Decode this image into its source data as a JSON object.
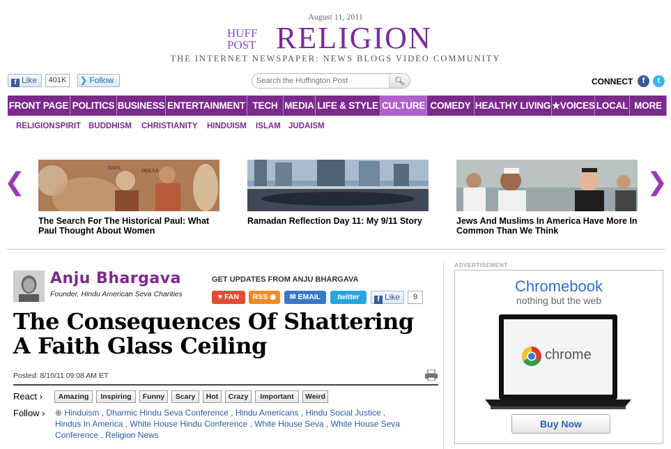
{
  "date": "August 11, 2011",
  "logo": {
    "huff": "HUFF",
    "post": "POST",
    "section": "RELIGION"
  },
  "tagline": "THE INTERNET NEWSPAPER: NEWS BLOGS VIDEO COMMUNITY",
  "social": {
    "like_label": "Like",
    "like_count": "401K",
    "follow_label": "Follow"
  },
  "search": {
    "placeholder": "Search the Huffington Post"
  },
  "connect": {
    "label": "CONNECT",
    "icons": [
      "facebook-icon",
      "twitter-icon"
    ]
  },
  "nav": {
    "items": [
      {
        "label": "FRONT PAGE",
        "active": false
      },
      {
        "label": "POLITICS",
        "active": false
      },
      {
        "label": "BUSINESS",
        "active": false
      },
      {
        "label": "ENTERTAINMENT",
        "active": false
      },
      {
        "label": "TECH",
        "active": false
      },
      {
        "label": "MEDIA",
        "active": false
      },
      {
        "label": "LIFE & STYLE",
        "active": false
      },
      {
        "label": "CULTURE",
        "active": true
      },
      {
        "label": "COMEDY",
        "active": false
      },
      {
        "label": "HEALTHY LIVING",
        "active": false
      },
      {
        "label": "★VOICES",
        "active": false
      },
      {
        "label": "LOCAL",
        "active": false
      },
      {
        "label": "MORE",
        "active": false
      }
    ],
    "bg_color": "#7b2a8c",
    "active_color": "#b061c9"
  },
  "subnav": [
    "RELIGION",
    "SPIRIT",
    "BUDDHISM",
    "CHRISTIANITY",
    "HINDUISM",
    "ISLAM",
    "JUDAISM"
  ],
  "carousel": [
    {
      "caption": "The Search For The Historical Paul: What Paul Thought About Women"
    },
    {
      "caption": "Ramadan Reflection Day 11: My 9/11 Story"
    },
    {
      "caption": "Jews And Muslims In America Have More In Common Than We Think"
    }
  ],
  "author": {
    "name": "Anju Bhargava",
    "title": "Founder, Hindu American Seva Charities"
  },
  "updates": {
    "label": "GET UPDATES FROM ANJU BHARGAVA",
    "fan": "FAN",
    "rss": "RSS",
    "email": "EMAIL",
    "twitter": "twitter",
    "like": "Like",
    "like_count": "9"
  },
  "article": {
    "headline": "The Consequences Of Shattering A Faith Glass Ceiling",
    "posted": "Posted: 8/10/11 09:08 AM ET"
  },
  "react": {
    "label": "React",
    "buttons": [
      "Amazing",
      "Inspiring",
      "Funny",
      "Scary",
      "Hot",
      "Crazy",
      "Important",
      "Weird"
    ]
  },
  "follow": {
    "label": "Follow",
    "tags": [
      "Hinduism",
      "Dharmic Hindu Seva Conference",
      "Hindu Americans",
      "Hindu Social Justice",
      "Hindus In America",
      "White House Hindu Conference",
      "White House Seva",
      "White House Seva Conference",
      "Religion News"
    ]
  },
  "ad": {
    "label": "ADVERTISEMENT",
    "title": "Chromebook",
    "subtitle": "nothing but the web",
    "chrome_text": "chrome",
    "button": "Buy Now"
  }
}
